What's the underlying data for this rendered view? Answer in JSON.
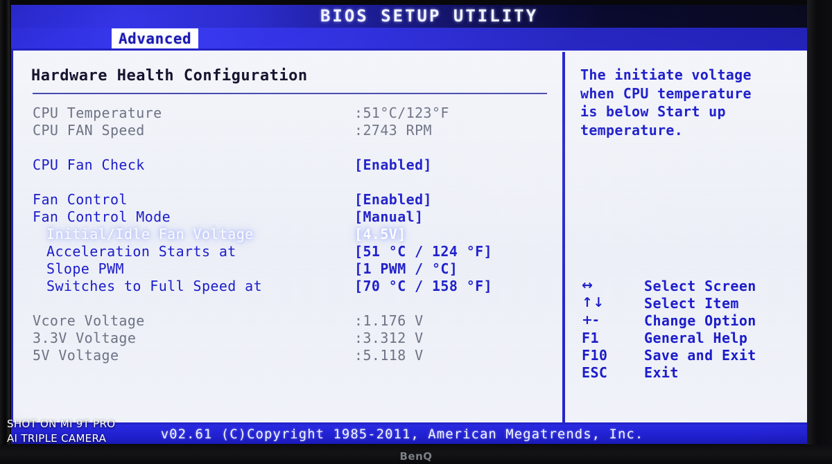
{
  "titlebar": {
    "title": "BIOS SETUP UTILITY"
  },
  "tabs": [
    {
      "label": "Advanced",
      "active": true
    }
  ],
  "main": {
    "section_title": "Hardware Health Configuration",
    "rows": [
      {
        "label": "CPU Temperature",
        "value": ":51°C/123°F",
        "kind": "readonly",
        "indent": 0
      },
      {
        "label": "CPU FAN Speed",
        "value": ":2743 RPM",
        "kind": "readonly",
        "indent": 0
      },
      {
        "label": "CPU Fan Check",
        "value": "[Enabled]",
        "kind": "option",
        "indent": 0
      },
      {
        "label": "Fan Control",
        "value": "[Enabled]",
        "kind": "option",
        "indent": 0
      },
      {
        "label": "Fan Control Mode",
        "value": "[Manual]",
        "kind": "option",
        "indent": 0
      },
      {
        "label": "Initial/Idle Fan Voltage",
        "value": "[4.5V]",
        "kind": "selected",
        "indent": 1
      },
      {
        "label": "Acceleration Starts at",
        "value": "[51 °C / 124 °F]",
        "kind": "option",
        "indent": 1
      },
      {
        "label": "Slope PWM",
        "value": "[1  PWM / °C]",
        "kind": "option",
        "indent": 1
      },
      {
        "label": "Switches to Full Speed at",
        "value": "[70 °C / 158 °F]",
        "kind": "option",
        "indent": 1
      },
      {
        "label": "Vcore Voltage",
        "value": ":1.176 V",
        "kind": "readonly",
        "indent": 0
      },
      {
        "label": "3.3V Voltage",
        "value": ":3.312 V",
        "kind": "readonly",
        "indent": 0
      },
      {
        "label": "5V Voltage",
        "value": ":5.118 V",
        "kind": "readonly",
        "indent": 0
      }
    ]
  },
  "help": {
    "lines": [
      "The initiate voltage",
      "when CPU temperature",
      "is below Start up",
      "temperature."
    ]
  },
  "keys": [
    {
      "key": "↔",
      "icon": "left-right-arrow-icon",
      "desc": "Select Screen"
    },
    {
      "key": "↑↓",
      "icon": "up-down-arrow-icon",
      "desc": "Select Item"
    },
    {
      "key": "+-",
      "icon": "plus-minus-icon",
      "desc": "Change Option"
    },
    {
      "key": "F1",
      "icon": "f1-key",
      "desc": "General Help"
    },
    {
      "key": "F10",
      "icon": "f10-key",
      "desc": "Save and Exit"
    },
    {
      "key": "ESC",
      "icon": "esc-key",
      "desc": "Exit"
    }
  ],
  "footer": {
    "text": "v02.61 (C)Copyright 1985-2011, American Megatrends, Inc."
  },
  "watermark": {
    "line1": "SHOT ON MI 9T PRO",
    "line2": "AI TRIPLE CAMERA"
  },
  "monitor": {
    "brand": "BenQ"
  },
  "colors": {
    "accent_blue": "#1c1ccb",
    "titlebar_blue": "#2b2bd8",
    "panel_bg": "#eef1f8",
    "readonly_gray": "#6d7384",
    "selected_white": "#fdfdff"
  }
}
